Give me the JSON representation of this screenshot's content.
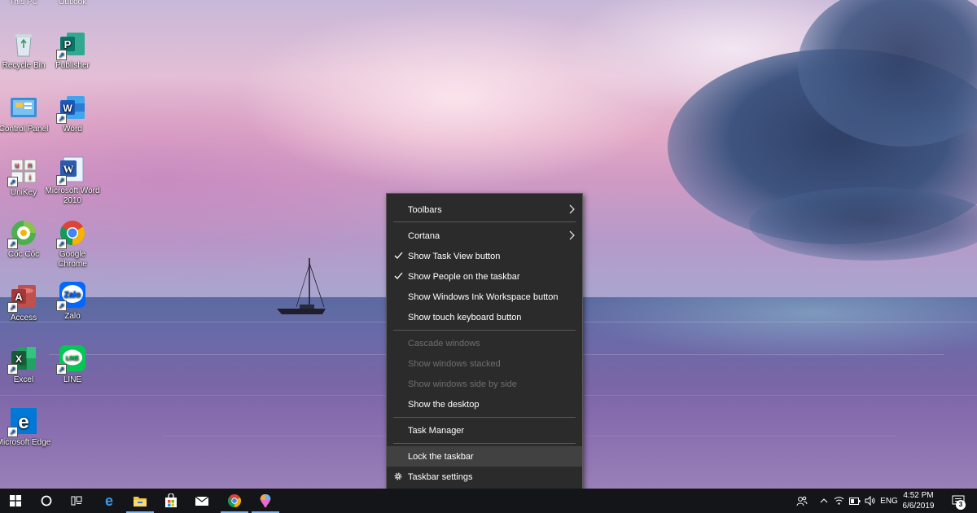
{
  "desktop": {
    "top_labels": [
      "This PC",
      "Outlook"
    ],
    "icons": [
      {
        "label": "Recycle Bin"
      },
      {
        "label": "Publisher"
      },
      {
        "label": "Control Panel"
      },
      {
        "label": "Word"
      },
      {
        "label": "UniKey"
      },
      {
        "label": "Microsoft Word 2010"
      },
      {
        "label": "Cốc Cốc"
      },
      {
        "label": "Google Chrome"
      },
      {
        "label": "Access"
      },
      {
        "label": "Zalo"
      },
      {
        "label": "Excel"
      },
      {
        "label": "LINE"
      },
      {
        "label": "Microsoft Edge"
      }
    ]
  },
  "context_menu": {
    "items": [
      {
        "label": "Toolbars",
        "submenu": true,
        "enabled": true
      },
      {
        "label": "Cortana",
        "submenu": true,
        "enabled": true
      },
      {
        "label": "Show Task View button",
        "checked": true,
        "enabled": true
      },
      {
        "label": "Show People on the taskbar",
        "checked": true,
        "enabled": true
      },
      {
        "label": "Show Windows Ink Workspace button",
        "enabled": true
      },
      {
        "label": "Show touch keyboard button",
        "enabled": true
      },
      {
        "label": "Cascade windows",
        "enabled": false
      },
      {
        "label": "Show windows stacked",
        "enabled": false
      },
      {
        "label": "Show windows side by side",
        "enabled": false
      },
      {
        "label": "Show the desktop",
        "enabled": true
      },
      {
        "label": "Task Manager",
        "enabled": true
      },
      {
        "label": "Lock the taskbar",
        "enabled": true,
        "highlighted": true
      },
      {
        "label": "Taskbar settings",
        "enabled": true,
        "icon": "gear-icon"
      }
    ]
  },
  "taskbar": {
    "apps": [
      "start-icon",
      "cortana-icon",
      "task-view-icon",
      "edge-icon",
      "file-explorer-icon",
      "store-icon",
      "mail-icon",
      "chrome-icon",
      "paint-3d-icon"
    ],
    "language": "ENG",
    "time": "4:52 PM",
    "date": "6/6/2019",
    "notification_count": "3"
  },
  "colors": {
    "menu_bg": "#2b2b2b",
    "menu_hover": "#414141",
    "taskbar_bg": "#141518",
    "accent": "#7ab4ea"
  }
}
